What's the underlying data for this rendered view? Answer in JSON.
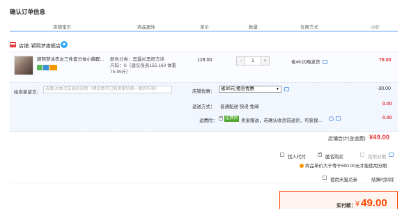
{
  "page": {
    "title": "确认订单信息"
  },
  "table_header": {
    "columns": [
      "店铺宝贝",
      "商品属性",
      "单价",
      "数量",
      "优惠方式",
      "小计"
    ]
  },
  "shop": {
    "prefix": "店铺:",
    "name": "颖熙梦旗舰店"
  },
  "item": {
    "name": "颖熙梦冰衣女三件套分体小胸配...",
    "attributes": [
      "颜色分类：黑露衫黑框方块",
      "尺码：S（建议身高155-160 体重",
      "75-95斤）"
    ],
    "price": "128.00",
    "quantity": "1",
    "qty_minus": "-",
    "qty_plus": "+",
    "shipping_promo": "省49:闪电发货",
    "subtotal": "79.00"
  },
  "options": {
    "message_label": "给卖家留言：",
    "message_placeholder": "选填:对本次交易的说明（建议填写已和卖家协商一致的内容）",
    "shop_discount_label": "店铺优惠：",
    "shop_discount_selected": "省30元:组合优惠",
    "shop_discount_amount": "-30.00",
    "delivery_label": "运送方式：",
    "delivery_value": "普通配送 快递 免邮",
    "delivery_amount": "0.00",
    "insurance_label": "运费险：",
    "insurance_tag": "运费险",
    "insurance_text": "卖家赠送，若确认收货前退货，可获保...",
    "insurance_amount": "0.00",
    "shop_total_label": "店铺合计(含运费)",
    "shop_total_amount": "¥49.00"
  },
  "checkout_options": {
    "proxy_pay": "找人代付",
    "anonymous": "匿名购买",
    "huabei": "花呗分期",
    "notice": "商品单价大于等于600.00元才能使用分期",
    "tmall_coupon": "使用天猫点券",
    "tmall_points": "结算时扣除"
  },
  "payment": {
    "label": "实付款：",
    "currency": "¥",
    "amount": "49.00"
  },
  "colors": {
    "accent": "#ff4400",
    "price_red": "#e4393c",
    "header_line": "#b2d1ff"
  }
}
